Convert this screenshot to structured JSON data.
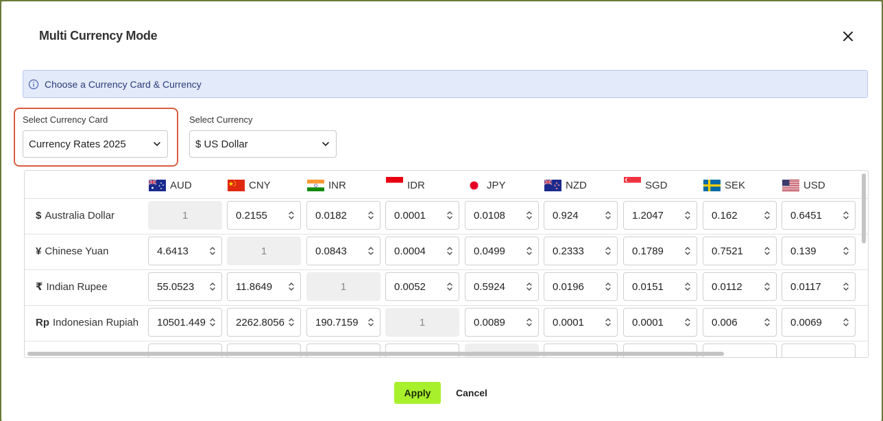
{
  "modal": {
    "title": "Multi Currency Mode",
    "info": "Choose a Currency Card & Currency"
  },
  "currency_card": {
    "label": "Select Currency Card",
    "value": "Currency Rates 2025"
  },
  "currency": {
    "label": "Select Currency",
    "value": "$ US Dollar"
  },
  "columns": [
    {
      "code": "AUD",
      "flag": "australia-flag"
    },
    {
      "code": "CNY",
      "flag": "china-flag"
    },
    {
      "code": "INR",
      "flag": "india-flag"
    },
    {
      "code": "IDR",
      "flag": "indonesia-flag"
    },
    {
      "code": "JPY",
      "flag": "japan-flag"
    },
    {
      "code": "NZD",
      "flag": "new-zealand-flag"
    },
    {
      "code": "SGD",
      "flag": "singapore-flag"
    },
    {
      "code": "SEK",
      "flag": "sweden-flag"
    },
    {
      "code": "USD",
      "flag": "usa-flag"
    }
  ],
  "rows": [
    {
      "symbol": "$",
      "name": "Australia Dollar",
      "values": [
        "1",
        "0.2155",
        "0.0182",
        "0.0001",
        "0.0108",
        "0.924",
        "1.2047",
        "0.162",
        "0.6451"
      ]
    },
    {
      "symbol": "¥",
      "name": "Chinese Yuan",
      "values": [
        "4.6413",
        "1",
        "0.0843",
        "0.0004",
        "0.0499",
        "0.2333",
        "0.1789",
        "0.7521",
        "0.139"
      ]
    },
    {
      "symbol": "₹",
      "name": "Indian Rupee",
      "values": [
        "55.0523",
        "11.8649",
        "1",
        "0.0052",
        "0.5924",
        "0.0196",
        "0.0151",
        "0.0112",
        "0.0117"
      ]
    },
    {
      "symbol": "Rp",
      "name": "Indonesian Rupiah",
      "values": [
        "10501.449",
        "2262.8056",
        "190.7159",
        "1",
        "0.0089",
        "0.0001",
        "0.0001",
        "0.006",
        "0.0069"
      ]
    }
  ],
  "actions": {
    "apply": "Apply",
    "cancel": "Cancel"
  },
  "colors": {
    "accent": "#a8f02c",
    "highlight_border": "#d95c3e",
    "info_bg": "#e3eaf9"
  }
}
